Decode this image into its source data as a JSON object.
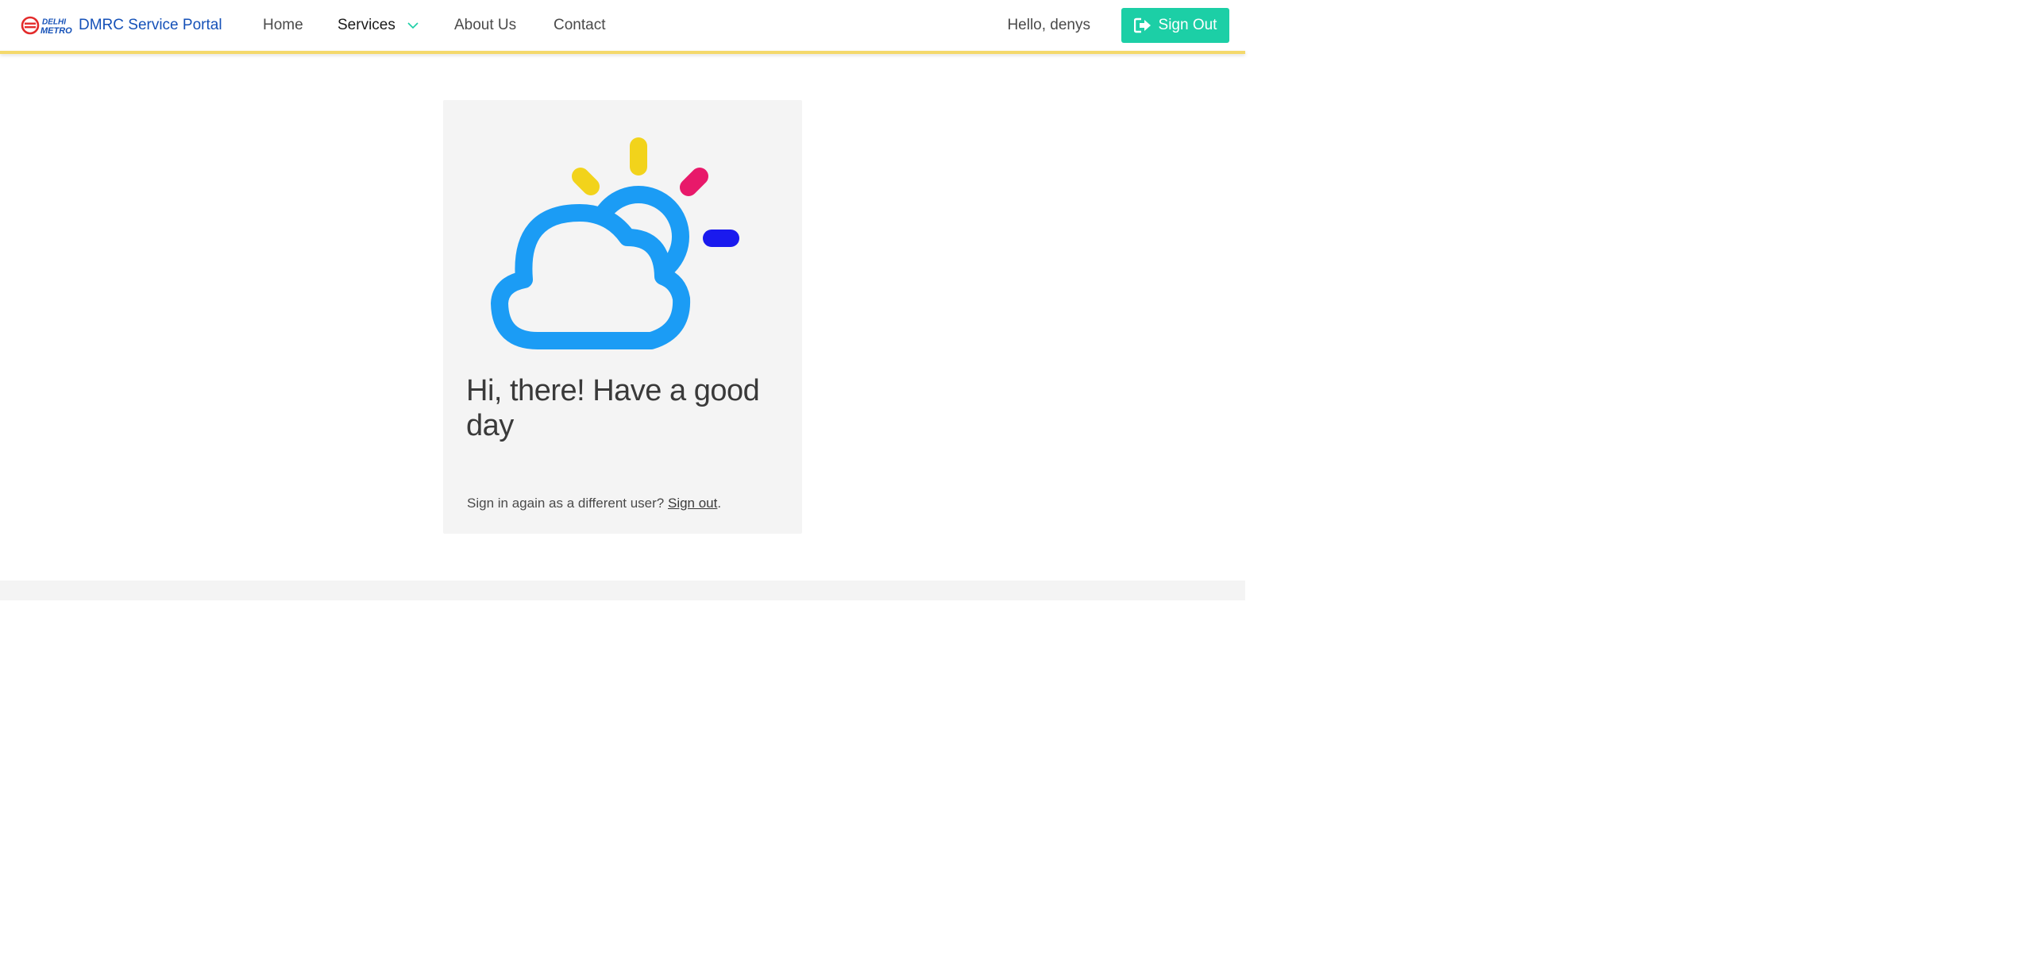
{
  "navbar": {
    "logo_top": "DELHI",
    "logo_bottom": "METRO",
    "brand_name": "DMRC Service Portal",
    "links": [
      {
        "label": "Home"
      },
      {
        "label": "Services"
      },
      {
        "label": "About Us"
      },
      {
        "label": "Contact"
      }
    ],
    "greeting": "Hello, denys",
    "signout_label": "Sign Out"
  },
  "card": {
    "heading": "Hi, there! Have a good day",
    "footer_text": "Sign in again as a different user?",
    "footer_link": "Sign out",
    "footer_end": "."
  },
  "colors": {
    "brand_blue": "#1551b8",
    "accent_teal": "#1ccfa6",
    "stripe_yellow": "#f4d96b",
    "cloud_blue": "#1b9cf5",
    "ray_yellow": "#f2d31b",
    "ray_pink": "#e8196a",
    "ray_blue": "#1a1aee"
  }
}
